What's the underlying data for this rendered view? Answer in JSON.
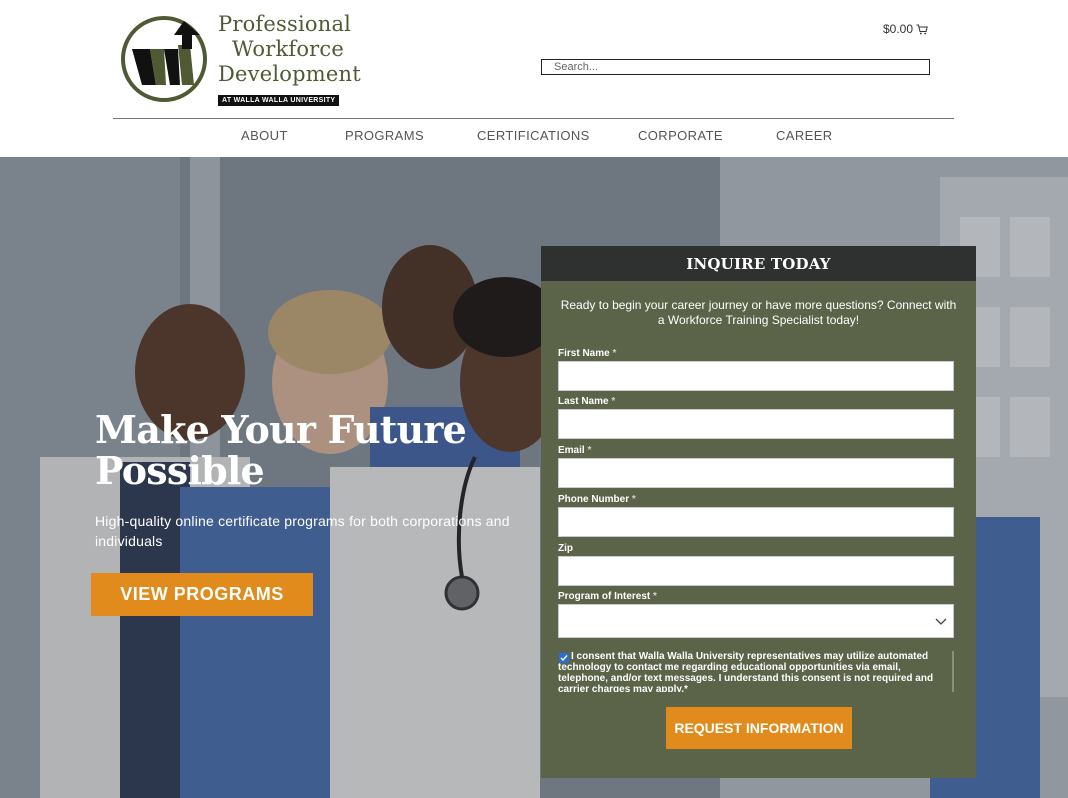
{
  "logo": {
    "line1": "Professional",
    "line2": "Workforce",
    "line3": "Development",
    "sub": "AT WALLA WALLA UNIVERSITY",
    "mark_icon": "wwu-logo-mark",
    "mark_color": "#4f5a34"
  },
  "cart": {
    "total": "$0.00",
    "icon": "cart-icon"
  },
  "search": {
    "placeholder": "Search..."
  },
  "nav": {
    "items": [
      {
        "label": "ABOUT"
      },
      {
        "label": "PROGRAMS"
      },
      {
        "label": "CERTIFICATIONS"
      },
      {
        "label": "CORPORATE"
      },
      {
        "label": "CAREER"
      }
    ]
  },
  "hero": {
    "headline_line1": "Make Your Future",
    "headline_line2": "Possible",
    "subhead": "High-quality online certificate programs for both corporations and individuals",
    "cta": "VIEW PROGRAMS",
    "cta_color": "#e08b1b"
  },
  "form": {
    "title": "INQUIRE TODAY",
    "intro": "Ready to begin your career journey or have more questions? Connect with a Workforce Training Specialist today!",
    "fields": [
      {
        "label": "First Name",
        "required": "*",
        "value": ""
      },
      {
        "label": "Last Name",
        "required": "*",
        "value": ""
      },
      {
        "label": "Email",
        "required": "*",
        "value": ""
      },
      {
        "label": "Phone Number",
        "required": "*",
        "value": ""
      },
      {
        "label": "Zip",
        "required": "",
        "value": ""
      },
      {
        "label": "Program of Interest",
        "required": "*",
        "value": ""
      }
    ],
    "consent_checked": true,
    "consent_text": "I consent that Walla Walla University representatives may utilize automated technology to contact me regarding educational opportunities via email, telephone, and/or text messages. I understand this consent is not required and carrier charges may apply.*",
    "submit": "REQUEST INFORMATION",
    "panel_color": "#5b6348",
    "header_color": "#2f3030"
  }
}
